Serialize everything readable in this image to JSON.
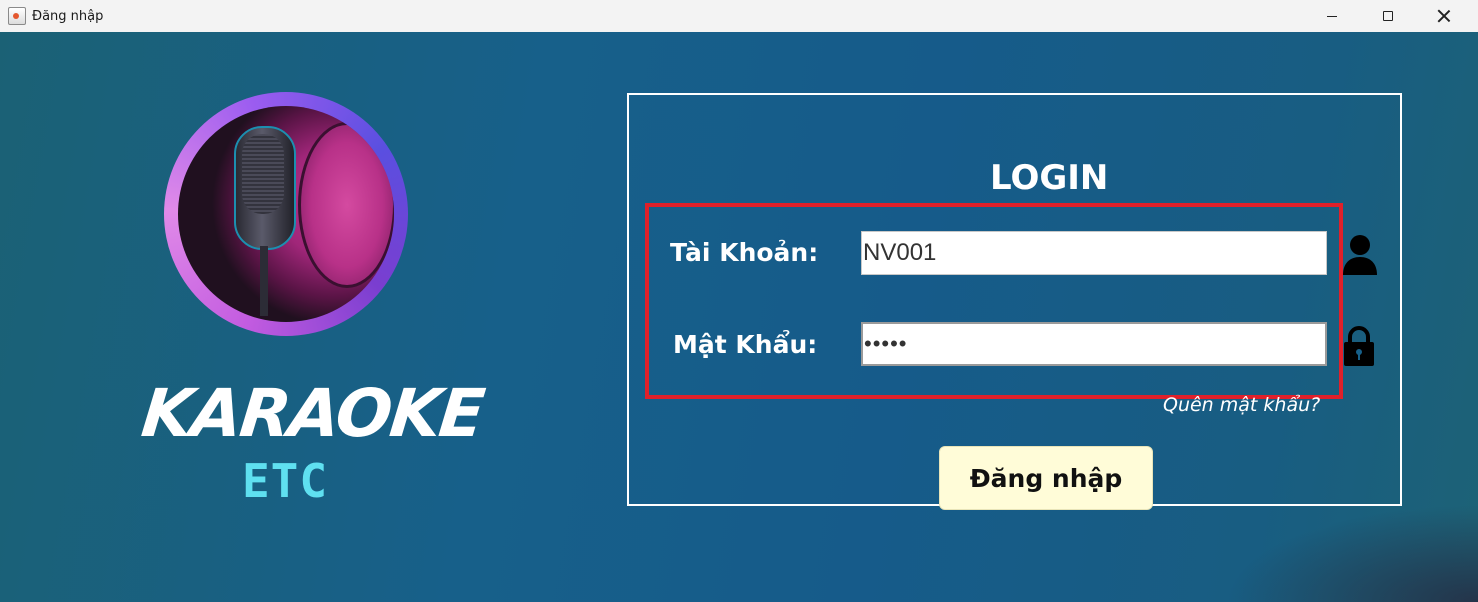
{
  "window": {
    "title": "Đăng nhập",
    "controls": [
      "minimize",
      "maximize",
      "close"
    ]
  },
  "logo": {
    "brand_line1": "KARAOKE",
    "brand_line2": "ETC",
    "image": "microphone-logo"
  },
  "login": {
    "heading": "LOGIN",
    "username_label": "Tài Khoản:",
    "username_value": "NV001",
    "password_label": "Mật Khẩu:",
    "password_value": "•••••",
    "username_icon": "user-icon",
    "password_icon": "lock-icon",
    "forgot_link": "Quên mật khẩu?",
    "submit_label": "Đăng nhập"
  },
  "colors": {
    "background": "#17608a",
    "panel_border": "#ffffff",
    "highlight_border": "#e0202a",
    "button_bg": "#fffcd8",
    "brand_etc": "#5fe0f0"
  }
}
